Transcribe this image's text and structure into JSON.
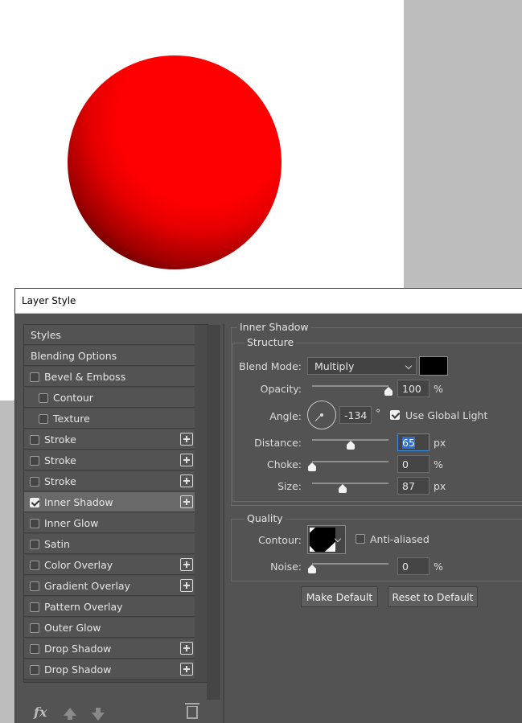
{
  "dialog": {
    "title": "Layer Style"
  },
  "styles_list": {
    "items": [
      {
        "label": "Styles",
        "checkbox": false,
        "checked": false,
        "plus": false,
        "indent": false,
        "selected": false
      },
      {
        "label": "Blending Options",
        "checkbox": false,
        "checked": false,
        "plus": false,
        "indent": false,
        "selected": false
      },
      {
        "label": "Bevel & Emboss",
        "checkbox": true,
        "checked": false,
        "plus": false,
        "indent": false,
        "selected": false
      },
      {
        "label": "Contour",
        "checkbox": true,
        "checked": false,
        "plus": false,
        "indent": true,
        "selected": false
      },
      {
        "label": "Texture",
        "checkbox": true,
        "checked": false,
        "plus": false,
        "indent": true,
        "selected": false
      },
      {
        "label": "Stroke",
        "checkbox": true,
        "checked": false,
        "plus": true,
        "indent": false,
        "selected": false
      },
      {
        "label": "Stroke",
        "checkbox": true,
        "checked": false,
        "plus": true,
        "indent": false,
        "selected": false
      },
      {
        "label": "Stroke",
        "checkbox": true,
        "checked": false,
        "plus": true,
        "indent": false,
        "selected": false
      },
      {
        "label": "Inner Shadow",
        "checkbox": true,
        "checked": true,
        "plus": true,
        "indent": false,
        "selected": true
      },
      {
        "label": "Inner Glow",
        "checkbox": true,
        "checked": false,
        "plus": false,
        "indent": false,
        "selected": false
      },
      {
        "label": "Satin",
        "checkbox": true,
        "checked": false,
        "plus": false,
        "indent": false,
        "selected": false
      },
      {
        "label": "Color Overlay",
        "checkbox": true,
        "checked": false,
        "plus": true,
        "indent": false,
        "selected": false
      },
      {
        "label": "Gradient Overlay",
        "checkbox": true,
        "checked": false,
        "plus": true,
        "indent": false,
        "selected": false
      },
      {
        "label": "Pattern Overlay",
        "checkbox": true,
        "checked": false,
        "plus": false,
        "indent": false,
        "selected": false
      },
      {
        "label": "Outer Glow",
        "checkbox": true,
        "checked": false,
        "plus": false,
        "indent": false,
        "selected": false
      },
      {
        "label": "Drop Shadow",
        "checkbox": true,
        "checked": false,
        "plus": true,
        "indent": false,
        "selected": false
      },
      {
        "label": "Drop Shadow",
        "checkbox": true,
        "checked": false,
        "plus": true,
        "indent": false,
        "selected": false
      }
    ],
    "footer_icons": [
      "fx-icon",
      "arrow-up-icon",
      "arrow-down-icon",
      "trash-icon"
    ],
    "fx_label": "fx"
  },
  "inner_shadow": {
    "section_title": "Inner Shadow",
    "structure_title": "Structure",
    "blend_mode_label": "Blend Mode:",
    "blend_mode_value": "Multiply",
    "shadow_color": "#000000",
    "opacity_label": "Opacity:",
    "opacity_value": "100",
    "opacity_unit": "%",
    "opacity_fraction": 1.0,
    "angle_label": "Angle:",
    "angle_value": "-134",
    "angle_unit": "°",
    "use_global_light_label": "Use Global Light",
    "use_global_light_checked": true,
    "distance_label": "Distance:",
    "distance_value": "65",
    "distance_unit": "px",
    "distance_fraction": 0.5,
    "choke_label": "Choke:",
    "choke_value": "0",
    "choke_unit": "%",
    "choke_fraction": 0.0,
    "size_label": "Size:",
    "size_value": "87",
    "size_unit": "px",
    "size_fraction": 0.4
  },
  "quality": {
    "title": "Quality",
    "contour_label": "Contour:",
    "anti_aliased_label": "Anti-aliased",
    "anti_aliased_checked": false,
    "noise_label": "Noise:",
    "noise_value": "0",
    "noise_unit": "%",
    "noise_fraction": 0.0
  },
  "buttons": {
    "make_default": "Make Default",
    "reset_to_default": "Reset to Default"
  },
  "canvas": {
    "sphere_color": "#ff0000",
    "background": "#ffffff"
  }
}
